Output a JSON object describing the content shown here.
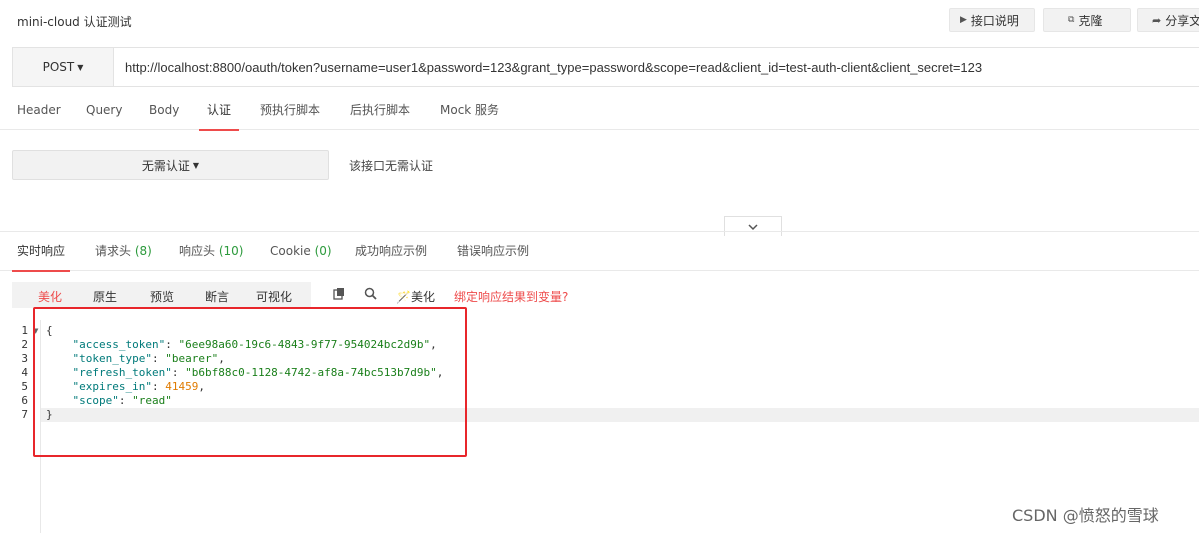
{
  "header": {
    "title": "mini-cloud 认证测试",
    "api_doc_label": "接口说明",
    "clone_label": "克隆",
    "share_label": "分享文档"
  },
  "request": {
    "method": "POST",
    "url": "http://localhost:8800/oauth/token?username=user1&password=123&grant_type=password&scope=read&client_id=test-auth-client&client_secret=123"
  },
  "request_tabs": [
    "Header",
    "Query",
    "Body",
    "认证",
    "预执行脚本",
    "后执行脚本",
    "Mock 服务"
  ],
  "auth": {
    "type_label": "无需认证",
    "note": "该接口无需认证"
  },
  "response_tabs": {
    "realtime": "实时响应",
    "req_headers": "请求头",
    "req_headers_count": "(8)",
    "resp_headers": "响应头",
    "resp_headers_count": "(10)",
    "cookie": "Cookie",
    "cookie_count": "(0)",
    "success_example": "成功响应示例",
    "error_example": "错误响应示例"
  },
  "view_modes": [
    "美化",
    "原生",
    "预览",
    "断言",
    "可视化"
  ],
  "toolbar": {
    "beautify_label": "美化",
    "bind_link": "绑定响应结果到变量?"
  },
  "response_body": {
    "line_numbers": [
      "1",
      "2",
      "3",
      "4",
      "5",
      "6",
      "7"
    ],
    "open_brace": "{",
    "close_brace": "}",
    "fields": [
      {
        "key": "\"access_token\"",
        "value": "\"6ee98a60-19c6-4843-9f77-954024bc2d9b\"",
        "kind": "string"
      },
      {
        "key": "\"token_type\"",
        "value": "\"bearer\"",
        "kind": "string"
      },
      {
        "key": "\"refresh_token\"",
        "value": "\"b6bf88c0-1128-4742-af8a-74bc513b7d9b\"",
        "kind": "string"
      },
      {
        "key": "\"expires_in\"",
        "value": "41459",
        "kind": "number"
      },
      {
        "key": "\"scope\"",
        "value": "\"read\"",
        "kind": "string"
      }
    ]
  },
  "watermark": "CSDN @愤怒的雪球",
  "colors": {
    "accent_red": "#ee4b4b",
    "count_green": "#2c9a3c",
    "json_key": "#007a7a",
    "json_string": "#1a7f1a",
    "json_number": "#e07b00",
    "highlight_box": "#e8262b"
  }
}
